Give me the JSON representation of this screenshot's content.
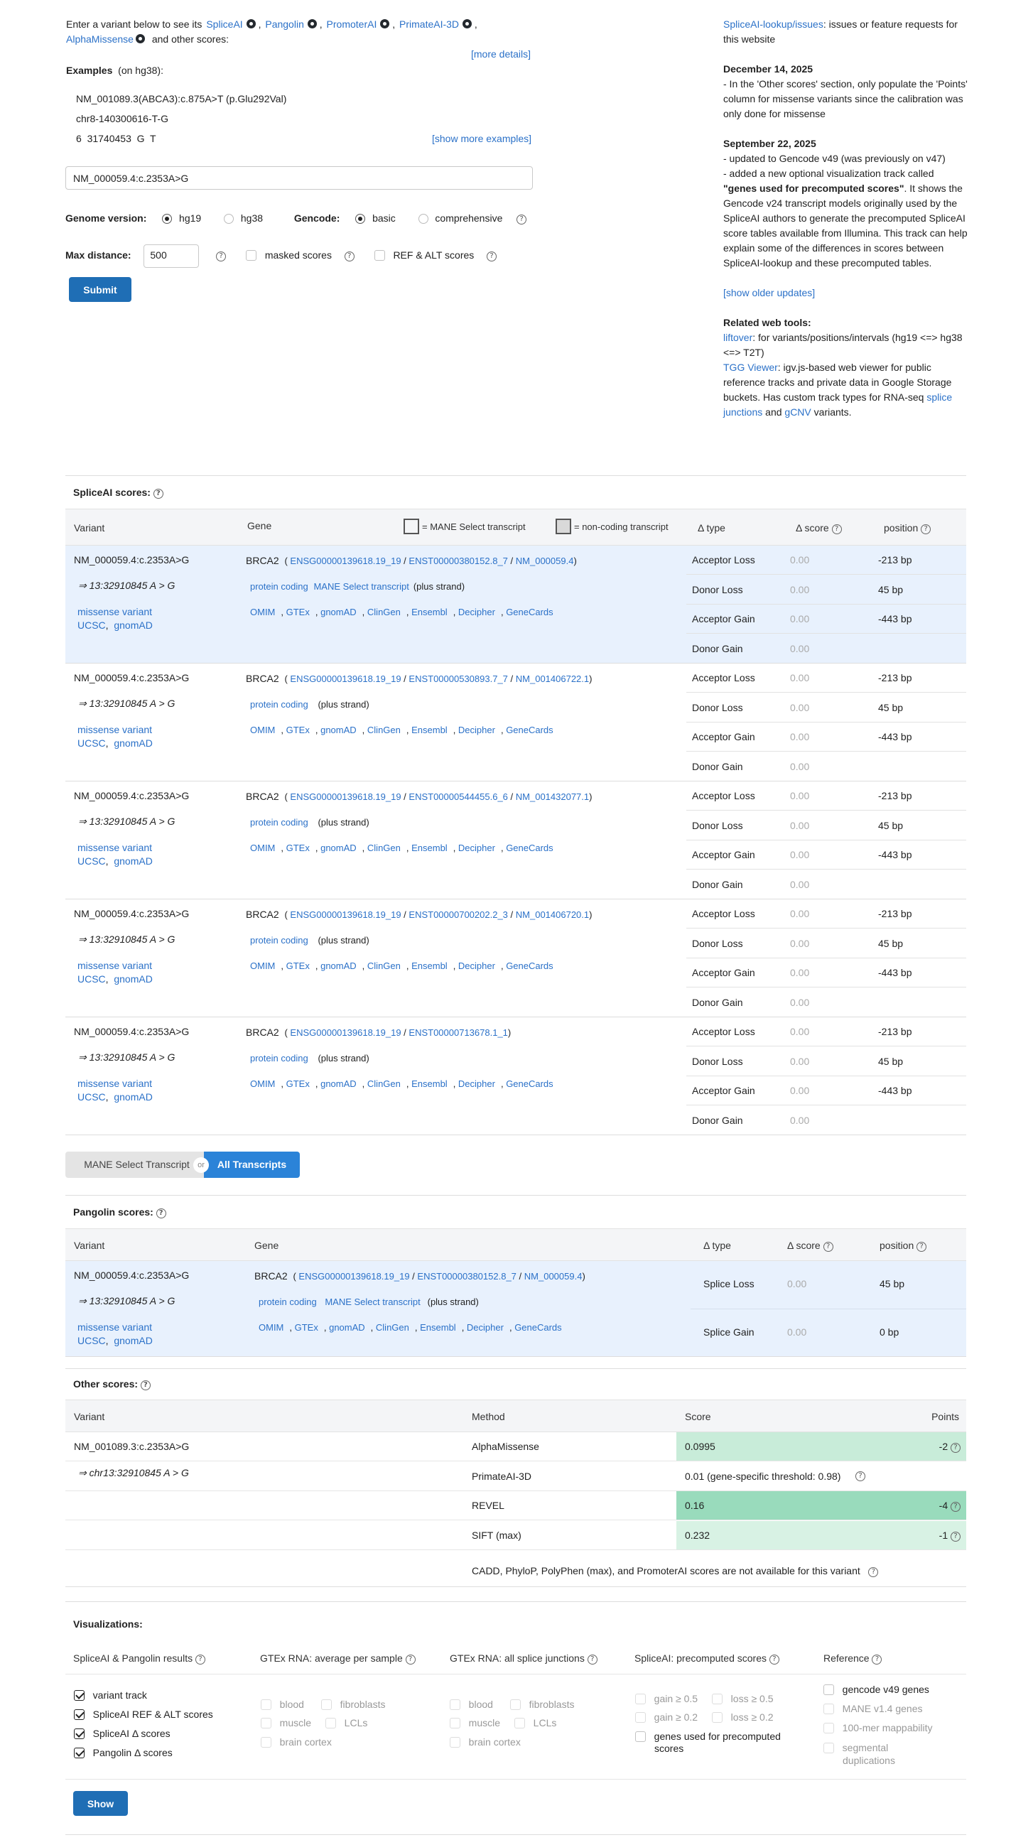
{
  "intro": {
    "prefix": "Enter a variant below to see its",
    "tools": [
      "SpliceAI",
      "Pangolin",
      "PromoterAI",
      "PrimateAI-3D",
      "AlphaMissense"
    ],
    "suffix": "and other scores:",
    "more_details": "[more details]"
  },
  "examples": {
    "label": "Examples",
    "sub": "(on hg38):",
    "items": [
      "NM_001089.3(ABCA3):c.875A>T (p.Glu292Val)",
      "chr8-140300616-T-G",
      "6  31740453  G  T"
    ],
    "show_more": "[show more examples]"
  },
  "form": {
    "variant_value": "NM_000059.4:c.2353A>G",
    "genome_label": "Genome version:",
    "genome_options": [
      "hg19",
      "hg38"
    ],
    "gencode_label": "Gencode:",
    "gencode_options": [
      "basic",
      "comprehensive"
    ],
    "maxd_label": "Max distance:",
    "maxd_value": "500",
    "masked_label": "masked scores",
    "refalt_label": "REF & ALT scores",
    "submit": "Submit"
  },
  "right": {
    "issues_link": "SpliceAI-lookup/issues",
    "issues_text": ": issues or feature requests for this website",
    "u1_date": "December 14, 2025",
    "u1_text": "- In the 'Other scores' section, only populate the 'Points' column for missense variants since the calibration was only done for missense",
    "u2_date": "September 22, 2025",
    "u2_line1": "- updated to Gencode v49 (was previously on v47)",
    "u2_line2a": "- added a new optional visualization track called ",
    "u2_line2b": "\"genes used for precomputed scores\"",
    "u2_line2c": ". It shows the Gencode v24 transcript models originally used by the SpliceAI authors to generate the precomputed SpliceAI score tables available from Illumina. This track can help explain some of the differences in scores between SpliceAI-lookup and these precomputed tables.",
    "older": "[show older updates]",
    "related": "Related web tools:",
    "liftover": "liftover",
    "liftover_text": ": for variants/positions/intervals (hg19 <=> hg38 <=> T2T)",
    "tgg": "TGG Viewer",
    "tgg_text": ": igv.js-based web viewer for public reference tracks and private data in Google Storage buckets. Has custom track types for RNA-seq ",
    "splice_junctions": "splice junctions",
    "and": " and ",
    "gcnv": "gCNV",
    "variants": " variants."
  },
  "spliceai": {
    "title": "SpliceAI scores:",
    "headers": {
      "variant": "Variant",
      "gene": "Gene",
      "mane_legend": "= MANE Select transcript",
      "nc_legend": "= non-coding transcript",
      "dtype": "Δ type",
      "dscore": "Δ score",
      "position": "position"
    },
    "variant": "NM_000059.4:c.2353A>G",
    "variant_pos": "⇒ 13:32910845 A > G",
    "missense": "missense variant",
    "ucsc": "UCSC",
    "gnomad": "gnomAD",
    "link_labels": [
      "OMIM",
      "GTEx",
      "gnomAD",
      "ClinGen",
      "Ensembl",
      "Decipher",
      "GeneCards"
    ],
    "blocks": [
      {
        "gene": "BRCA2",
        "ensg": "ENSG00000139618.19_19",
        "enst": "ENST00000380152.8_7",
        "nm": "NM_000059.4",
        "biotype": "protein coding",
        "mane": "MANE Select transcript",
        "strand": "(plus strand)",
        "rows": [
          {
            "t": "Acceptor Loss",
            "s": "0.00",
            "p": "-213 bp"
          },
          {
            "t": "Donor Loss",
            "s": "0.00",
            "p": "45 bp"
          },
          {
            "t": "Acceptor Gain",
            "s": "0.00",
            "p": "-443 bp"
          },
          {
            "t": "Donor Gain",
            "s": "0.00",
            "p": ""
          }
        ]
      },
      {
        "gene": "BRCA2",
        "ensg": "ENSG00000139618.19_19",
        "enst": "ENST00000530893.7_7",
        "nm": "NM_001406722.1",
        "biotype": "protein coding",
        "mane": "",
        "strand": "(plus strand)",
        "rows": [
          {
            "t": "Acceptor Loss",
            "s": "0.00",
            "p": "-213 bp"
          },
          {
            "t": "Donor Loss",
            "s": "0.00",
            "p": "45 bp"
          },
          {
            "t": "Acceptor Gain",
            "s": "0.00",
            "p": "-443 bp"
          },
          {
            "t": "Donor Gain",
            "s": "0.00",
            "p": ""
          }
        ]
      },
      {
        "gene": "BRCA2",
        "ensg": "ENSG00000139618.19_19",
        "enst": "ENST00000544455.6_6",
        "nm": "NM_001432077.1",
        "biotype": "protein coding",
        "mane": "",
        "strand": "(plus strand)",
        "rows": [
          {
            "t": "Acceptor Loss",
            "s": "0.00",
            "p": "-213 bp"
          },
          {
            "t": "Donor Loss",
            "s": "0.00",
            "p": "45 bp"
          },
          {
            "t": "Acceptor Gain",
            "s": "0.00",
            "p": "-443 bp"
          },
          {
            "t": "Donor Gain",
            "s": "0.00",
            "p": ""
          }
        ]
      },
      {
        "gene": "BRCA2",
        "ensg": "ENSG00000139618.19_19",
        "enst": "ENST00000700202.2_3",
        "nm": "NM_001406720.1",
        "biotype": "protein coding",
        "mane": "",
        "strand": "(plus strand)",
        "rows": [
          {
            "t": "Acceptor Loss",
            "s": "0.00",
            "p": "-213 bp"
          },
          {
            "t": "Donor Loss",
            "s": "0.00",
            "p": "45 bp"
          },
          {
            "t": "Acceptor Gain",
            "s": "0.00",
            "p": "-443 bp"
          },
          {
            "t": "Donor Gain",
            "s": "0.00",
            "p": ""
          }
        ]
      },
      {
        "gene": "BRCA2",
        "ensg": "ENSG00000139618.19_19",
        "enst": "ENST00000713678.1_1",
        "nm": "",
        "biotype": "protein coding",
        "mane": "",
        "strand": "(plus strand)",
        "rows": [
          {
            "t": "Acceptor Loss",
            "s": "0.00",
            "p": "-213 bp"
          },
          {
            "t": "Donor Loss",
            "s": "0.00",
            "p": "45 bp"
          },
          {
            "t": "Acceptor Gain",
            "s": "0.00",
            "p": "-443 bp"
          },
          {
            "t": "Donor Gain",
            "s": "0.00",
            "p": ""
          }
        ]
      }
    ]
  },
  "toggle": {
    "mane": "MANE Select Transcript",
    "or": "or",
    "all": "All Transcripts"
  },
  "pangolin": {
    "title": "Pangolin scores:",
    "headers": {
      "variant": "Variant",
      "gene": "Gene",
      "dtype": "Δ type",
      "dscore": "Δ score",
      "position": "position"
    },
    "gene": "BRCA2",
    "ensg": "ENSG00000139618.19_19",
    "enst": "ENST00000380152.8_7",
    "nm": "NM_000059.4",
    "biotype": "protein coding",
    "mane": "MANE Select transcript",
    "strand": "(plus strand)",
    "rows": [
      {
        "t": "Splice Loss",
        "s": "0.00",
        "p": "45 bp"
      },
      {
        "t": "Splice Gain",
        "s": "0.00",
        "p": "0 bp"
      }
    ]
  },
  "other": {
    "title": "Other scores:",
    "headers": {
      "variant": "Variant",
      "method": "Method",
      "score": "Score",
      "points": "Points"
    },
    "variant": "NM_001089.3:c.2353A>G",
    "variant_pos": "⇒ chr13:32910845 A > G",
    "rows": [
      {
        "method": "AlphaMissense",
        "score": "0.0995",
        "points": "-2",
        "color": "#c8ecd9"
      },
      {
        "method": "PrimateAI-3D",
        "score": "0.01  (gene-specific threshold: 0.98)",
        "points": "",
        "color": "#ffffff"
      },
      {
        "method": "REVEL",
        "score": "0.16",
        "points": "-4",
        "color": "#99dbbc"
      },
      {
        "method": "SIFT (max)",
        "score": "0.232",
        "points": "-1",
        "color": "#d8f2e4"
      }
    ],
    "na_note": "CADD,  PhyloP,  PolyPhen (max),  and PromoterAI scores are not available for this variant"
  },
  "viz": {
    "title": "Visualizations:",
    "col1": {
      "h": "SpliceAI & Pangolin results",
      "items": [
        "variant track",
        "SpliceAI REF & ALT scores",
        "SpliceAI Δ  scores",
        "Pangolin Δ  scores"
      ]
    },
    "col2": {
      "h": "GTEx RNA: average per sample",
      "items": [
        "blood",
        "fibroblasts",
        "muscle",
        "LCLs",
        "brain cortex"
      ]
    },
    "col3": {
      "h": "GTEx RNA: all splice junctions",
      "items": [
        "blood",
        "fibroblasts",
        "muscle",
        "LCLs",
        "brain cortex"
      ]
    },
    "col4": {
      "h": "SpliceAI: precomputed scores",
      "items": [
        "gain ≥ 0.5",
        "loss ≥ 0.5",
        "gain ≥ 0.2",
        "loss ≥ 0.2",
        "genes used for precomputed",
        "scores"
      ]
    },
    "col5": {
      "h": "Reference",
      "items": [
        "gencode v49 genes",
        "MANE v1.4 genes",
        "100-mer mappability",
        "segmental",
        "duplications"
      ]
    },
    "show": "Show"
  }
}
